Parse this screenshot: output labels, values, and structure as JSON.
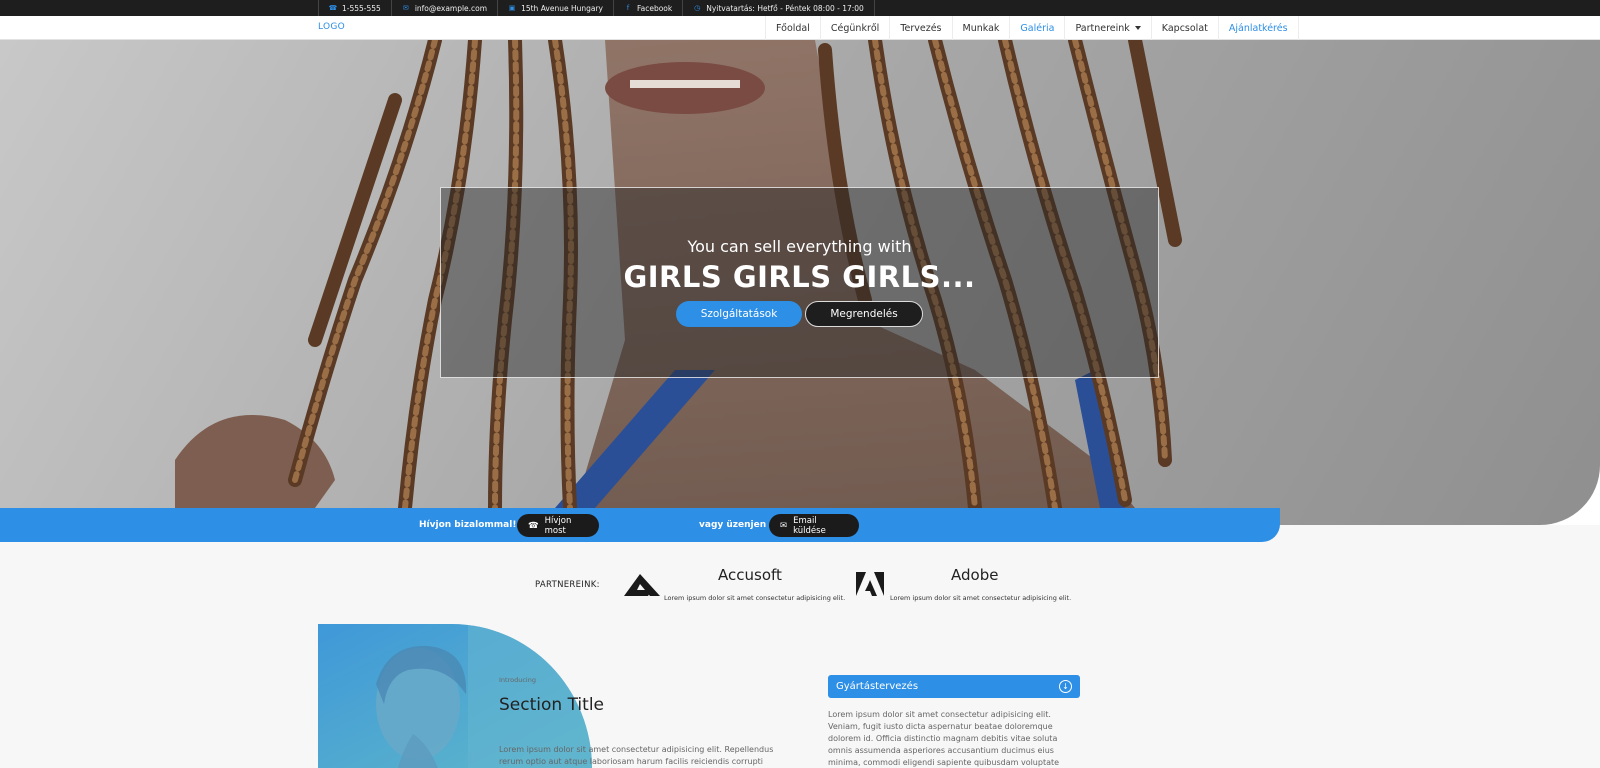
{
  "topbar": {
    "items": [
      {
        "icon": "phone-icon",
        "text": "1-555-555"
      },
      {
        "icon": "mail-icon",
        "text": "info@example.com"
      },
      {
        "icon": "building-icon",
        "text": "15th Avenue Hungary"
      },
      {
        "icon": "facebook-icon",
        "text": "Facebook"
      },
      {
        "icon": "clock-icon",
        "text": "Nyitvatartás: Hetfő - Péntek 08:00 - 17:00"
      }
    ]
  },
  "nav": {
    "logo": "LOGO",
    "items": [
      {
        "label": "Főoldal"
      },
      {
        "label": "Cégünkről"
      },
      {
        "label": "Tervezés"
      },
      {
        "label": "Munkak"
      },
      {
        "label": "Galéria"
      },
      {
        "label": "Partnereink"
      },
      {
        "label": "Kapcsolat"
      },
      {
        "label": "Ajánlatkérés"
      }
    ]
  },
  "hero": {
    "subtitle": "You can sell everything with",
    "title": "GIRLS GIRLS GIRLS...",
    "primary_button": "Szolgáltatások",
    "secondary_button": "Megrendelés"
  },
  "callstrip": {
    "text1": "Hívjon bizalommal!",
    "call_button": "Hívjon most",
    "text2": "vagy üzenjen",
    "email_button": "Email küldése"
  },
  "partners": {
    "label": "PARTNEREINK:",
    "items": [
      {
        "name": "Accusoft",
        "desc": "Lorem ipsum dolor sit amet consectetur adipisicing elit."
      },
      {
        "name": "Adobe",
        "desc": "Lorem ipsum dolor sit amet consectetur adipisicing elit."
      }
    ]
  },
  "section": {
    "intro": "Introducing",
    "title": "Section Title",
    "text": "Lorem ipsum dolor sit amet consectetur adipisicing elit. Repellendus rerum optio aut atque laboriosam harum facilis reiciendis corrupti"
  },
  "accordion": {
    "title": "Gyártástervezés",
    "text": "Lorem ipsum dolor sit amet consectetur adipisicing elit. Veniam, fugit iusto dicta aspernatur beatae doloremque dolorem id. Officia distinctio magnam debitis vitae soluta omnis assumenda asperiores accusantium ducimus eius minima, commodi eligendi sapiente quibusdam voluptate"
  },
  "colors": {
    "accent": "#2d8fe6",
    "dark": "#1e1e1e"
  }
}
